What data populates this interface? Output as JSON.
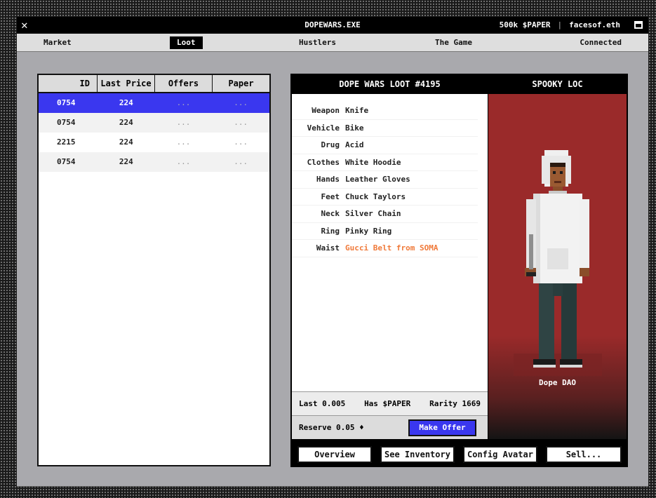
{
  "window": {
    "title": "DOPEWARS.EXE",
    "balance": "500k $PAPER",
    "separator": "|",
    "account": "facesof.eth",
    "close_glyph": "✕"
  },
  "nav": {
    "market": "Market",
    "loot": "Loot",
    "hustlers": "Hustlers",
    "the_game": "The Game",
    "connected": "Connected",
    "active": "Loot"
  },
  "table": {
    "columns": [
      "ID",
      "Last Price",
      "Offers",
      "Paper"
    ],
    "rows": [
      {
        "id": "0754",
        "price": "224",
        "offers": "...",
        "paper": "...",
        "selected": true
      },
      {
        "id": "0754",
        "price": "224",
        "offers": "...",
        "paper": "..."
      },
      {
        "id": "2215",
        "price": "224",
        "offers": "...",
        "paper": "..."
      },
      {
        "id": "0754",
        "price": "224",
        "offers": "...",
        "paper": "..."
      }
    ]
  },
  "loot": {
    "title": "DOPE WARS LOOT #4195",
    "items": [
      {
        "slot": "Weapon",
        "name": "Knife"
      },
      {
        "slot": "Vehicle",
        "name": "Bike"
      },
      {
        "slot": "Drug",
        "name": "Acid"
      },
      {
        "slot": "Clothes",
        "name": "White Hoodie"
      },
      {
        "slot": "Hands",
        "name": "Leather Gloves"
      },
      {
        "slot": "Feet",
        "name": "Chuck Taylors"
      },
      {
        "slot": "Neck",
        "name": "Silver Chain"
      },
      {
        "slot": "Ring",
        "name": "Pinky Ring"
      },
      {
        "slot": "Waist",
        "name": "Gucci Belt from SOMA",
        "rare": true
      }
    ],
    "last": "Last 0.005",
    "has_paper": "Has $PAPER",
    "rarity": "Rarity 1669",
    "reserve": "Reserve 0.05 ♦",
    "make_offer": "Make Offer"
  },
  "hustler": {
    "name": "SPOOKY LOC",
    "dao_label": "Dope DAO",
    "bg_color": "#9a2a2a"
  },
  "buttons": {
    "overview": "Overview",
    "see_inventory": "See Inventory",
    "config_avatar": "Config Avatar",
    "sell": "Sell..."
  },
  "colors": {
    "accent": "#3a37ef",
    "rare": "#f07a3a"
  }
}
